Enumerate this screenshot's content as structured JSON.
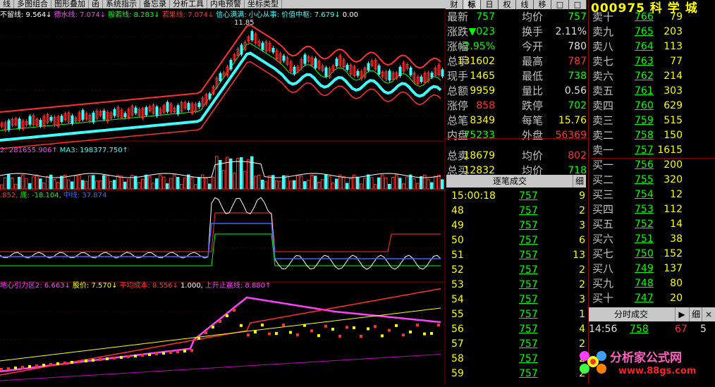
{
  "toolbar": {
    "items": [
      "线",
      "多图组合",
      "图形叠加",
      "函",
      "系统指示",
      "备忘录",
      "分析工具",
      "内电预警",
      "坐标类型"
    ]
  },
  "right_tabs": [
    "财",
    "标",
    "日",
    "权",
    "线",
    "移",
    "□",
    "□"
  ],
  "stock_title": "000975 科 学 城",
  "indicators": {
    "main": [
      {
        "text": "不留线: 9.564↓",
        "color": "#ffffff"
      },
      {
        "text": "德水线: 7.074↓",
        "color": "#ff40ff"
      },
      {
        "text": "般若线: 8.283↓",
        "color": "#00ff00"
      },
      {
        "text": "若果线: 7.074↓",
        "color": "#ff3030"
      },
      {
        "text": "信心满满:",
        "color": "#40ffff"
      },
      {
        "text": "小心从事: 价值中枢: 7.679↓",
        "color": "#40ffff"
      },
      {
        "text": "0.00",
        "color": "#ffffff"
      }
    ],
    "high_label": "11.85",
    "volume": [
      {
        "text": "2: 281655.906↑",
        "color": "#ff40ff"
      },
      {
        "text": "MA3: 198377.750↑",
        "color": "#40ffff"
      }
    ],
    "osc": [
      {
        "text": ".852,",
        "color": "#ff3030"
      },
      {
        "text": "底: -18.104,",
        "color": "#00ff00"
      },
      {
        "text": "中线: 37.874",
        "color": "#4060ff"
      }
    ],
    "bottom": [
      {
        "text": "地心引力区2: 6.663↓",
        "color": "#ff40ff"
      },
      {
        "text": "股价: 7.570↓",
        "color": "#ffff00"
      },
      {
        "text": "平均成本: 8.556↓",
        "color": "#ff3030"
      },
      {
        "text": "1.000,",
        "color": "#ffffff"
      },
      {
        "text": "上升止赢线: 8.880↑",
        "color": "#ff40ff"
      }
    ]
  },
  "quote": [
    {
      "l1": "最新",
      "v1": "757",
      "c1": "#00ff00",
      "l2": "均价",
      "v2": "757",
      "c2": "#00ff00"
    },
    {
      "l1": "涨跌",
      "v1": "▼023",
      "c1": "#00ff00",
      "l2": "换手",
      "v2": "2.11%",
      "c2": "#e0e0e0"
    },
    {
      "l1": "涨幅",
      "v1": "-2.95%",
      "c1": "#00ff00",
      "l2": "今开",
      "v2": "780",
      "c2": "#e0e0e0"
    },
    {
      "l1": "总手",
      "v1": "131602",
      "c1": "#ffff00",
      "l2": "最高",
      "v2": "787",
      "c2": "#ff3030"
    },
    {
      "l1": "现手",
      "v1": "1465",
      "c1": "#ffff00",
      "l2": "最低",
      "v2": "738",
      "c2": "#00ff00"
    },
    {
      "l1": "总额",
      "v1": "9959",
      "c1": "#ffff00",
      "l2": "量比",
      "v2": "0.56",
      "c2": "#e0e0e0"
    },
    {
      "l1": "涨停",
      "v1": "858",
      "c1": "#ff3030",
      "l2": "跌停",
      "v2": "702",
      "c2": "#00ff00"
    },
    {
      "l1": "总笔",
      "v1": "8349",
      "c1": "#ffff00",
      "l2": "每笔",
      "v2": "15.76",
      "c2": "#ffff00"
    },
    {
      "l1": "内盘",
      "v1": "75233",
      "c1": "#00ff00",
      "l2": "外盘",
      "v2": "56369",
      "c2": "#ff3030"
    },
    {
      "l1": "总卖",
      "v1": "18679",
      "c1": "#ffff00",
      "l2": "均价",
      "v2": "802",
      "c2": "#ff3030"
    },
    {
      "l1": "总买",
      "v1": "12832",
      "c1": "#ffff00",
      "l2": "均价",
      "v2": "718",
      "c2": "#00ff00"
    }
  ],
  "order_book": [
    {
      "label": "卖十",
      "price": "766",
      "vol": "79",
      "color": "#00ff00"
    },
    {
      "label": "卖九",
      "price": "765",
      "vol": "203",
      "color": "#00ff00"
    },
    {
      "label": "卖八",
      "price": "764",
      "vol": "113",
      "color": "#00ff00"
    },
    {
      "label": "卖七",
      "price": "763",
      "vol": "77",
      "color": "#00ff00"
    },
    {
      "label": "卖六",
      "price": "762",
      "vol": "214",
      "color": "#00ff00"
    },
    {
      "label": "卖五",
      "price": "761",
      "vol": "303",
      "color": "#00ff00"
    },
    {
      "label": "卖四",
      "price": "760",
      "vol": "629",
      "color": "#00ff00"
    },
    {
      "label": "卖三",
      "price": "759",
      "vol": "515",
      "color": "#00ff00"
    },
    {
      "label": "卖二",
      "price": "758",
      "vol": "150",
      "color": "#00ff00"
    },
    {
      "label": "卖一",
      "price": "757",
      "vol": "1615",
      "color": "#00ff00"
    },
    {
      "label": "买一",
      "price": "756",
      "vol": "200",
      "color": "#00ff00"
    },
    {
      "label": "买二",
      "price": "755",
      "vol": "320",
      "color": "#00ff00"
    },
    {
      "label": "买三",
      "price": "754",
      "vol": "12",
      "color": "#00ff00"
    },
    {
      "label": "买四",
      "price": "753",
      "vol": "112",
      "color": "#00ff00"
    },
    {
      "label": "买五",
      "price": "752",
      "vol": "14",
      "color": "#00ff00"
    },
    {
      "label": "买六",
      "price": "751",
      "vol": "38",
      "color": "#00ff00"
    },
    {
      "label": "买七",
      "price": "750",
      "vol": "152",
      "color": "#00ff00"
    },
    {
      "label": "买八",
      "price": "749",
      "vol": "137",
      "color": "#00ff00"
    },
    {
      "label": "买九",
      "price": "748",
      "vol": "80",
      "color": "#00ff00"
    },
    {
      "label": "买十",
      "price": "747",
      "vol": "20",
      "color": "#00ff00"
    }
  ],
  "ticks": {
    "title": "逐笔成交",
    "button": "细",
    "rows": [
      {
        "t": "15:00:18",
        "p": "757",
        "v": "9"
      },
      {
        "t": "48",
        "p": "757",
        "v": "2"
      },
      {
        "t": "49",
        "p": "757",
        "v": "3"
      },
      {
        "t": "50",
        "p": "757",
        "v": "6"
      },
      {
        "t": "51",
        "p": "757",
        "v": "13"
      },
      {
        "t": "52",
        "p": "757",
        "v": "2"
      },
      {
        "t": "53",
        "p": "757",
        "v": "2"
      },
      {
        "t": "54",
        "p": "757",
        "v": "3"
      },
      {
        "t": "55",
        "p": "757",
        "v": "1"
      },
      {
        "t": "56",
        "p": "757",
        "v": "4"
      },
      {
        "t": "57",
        "p": "757",
        "v": "2"
      },
      {
        "t": "58",
        "p": "757",
        "v": "2"
      },
      {
        "t": "59",
        "p": "757",
        "v": "2"
      }
    ]
  },
  "fenshi": {
    "title": "分时成交",
    "button": "细",
    "time": "14:56",
    "price": "758",
    "vol": "67",
    "num": "5"
  },
  "logo": {
    "brand": "分析家公式网",
    "url": "www.88gs.com"
  }
}
